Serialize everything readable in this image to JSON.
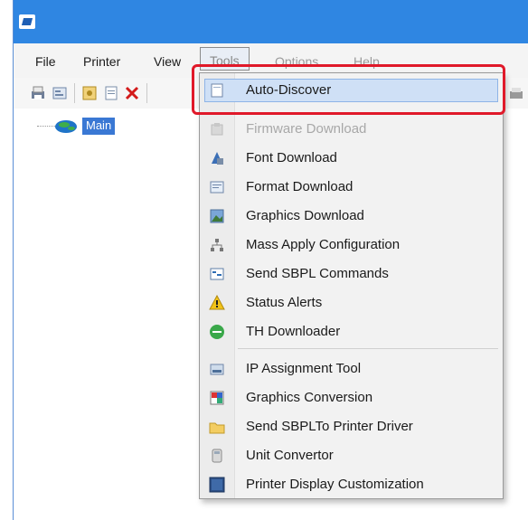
{
  "menubar": {
    "file": "File",
    "printer": "Printer",
    "view": "View",
    "tools": "Tools",
    "options": "Options",
    "help": "Help"
  },
  "tree": {
    "root_label": "Main"
  },
  "tools_menu": {
    "items": [
      {
        "label": "Auto-Discover",
        "icon": "auto-discover-icon",
        "state": "highlighted"
      },
      {
        "label": "Firmware Download",
        "icon": "firmware-icon",
        "state": "disabled"
      },
      {
        "label": "Font Download",
        "icon": "font-download-icon",
        "state": "enabled"
      },
      {
        "label": "Format Download",
        "icon": "format-download-icon",
        "state": "enabled"
      },
      {
        "label": "Graphics Download",
        "icon": "graphics-download-icon",
        "state": "enabled"
      },
      {
        "label": "Mass Apply Configuration",
        "icon": "network-icon",
        "state": "enabled"
      },
      {
        "label": "Send SBPL Commands",
        "icon": "commands-icon",
        "state": "enabled"
      },
      {
        "label": "Status Alerts",
        "icon": "warning-icon",
        "state": "enabled"
      },
      {
        "label": "TH Downloader",
        "icon": "th-downloader-icon",
        "state": "enabled"
      },
      {
        "label": "IP Assignment Tool",
        "icon": "ip-tool-icon",
        "state": "enabled"
      },
      {
        "label": "Graphics Conversion",
        "icon": "graphics-conversion-icon",
        "state": "enabled"
      },
      {
        "label": "Send SBPLTo Printer Driver",
        "icon": "folder-icon",
        "state": "enabled"
      },
      {
        "label": "Unit Convertor",
        "icon": "unit-convertor-icon",
        "state": "enabled"
      },
      {
        "label": "Printer Display Customization",
        "icon": "display-icon",
        "state": "enabled"
      }
    ]
  },
  "colors": {
    "titlebar": "#2f86e2",
    "highlight_box": "#e0192a",
    "selection": "#3a78d4"
  }
}
